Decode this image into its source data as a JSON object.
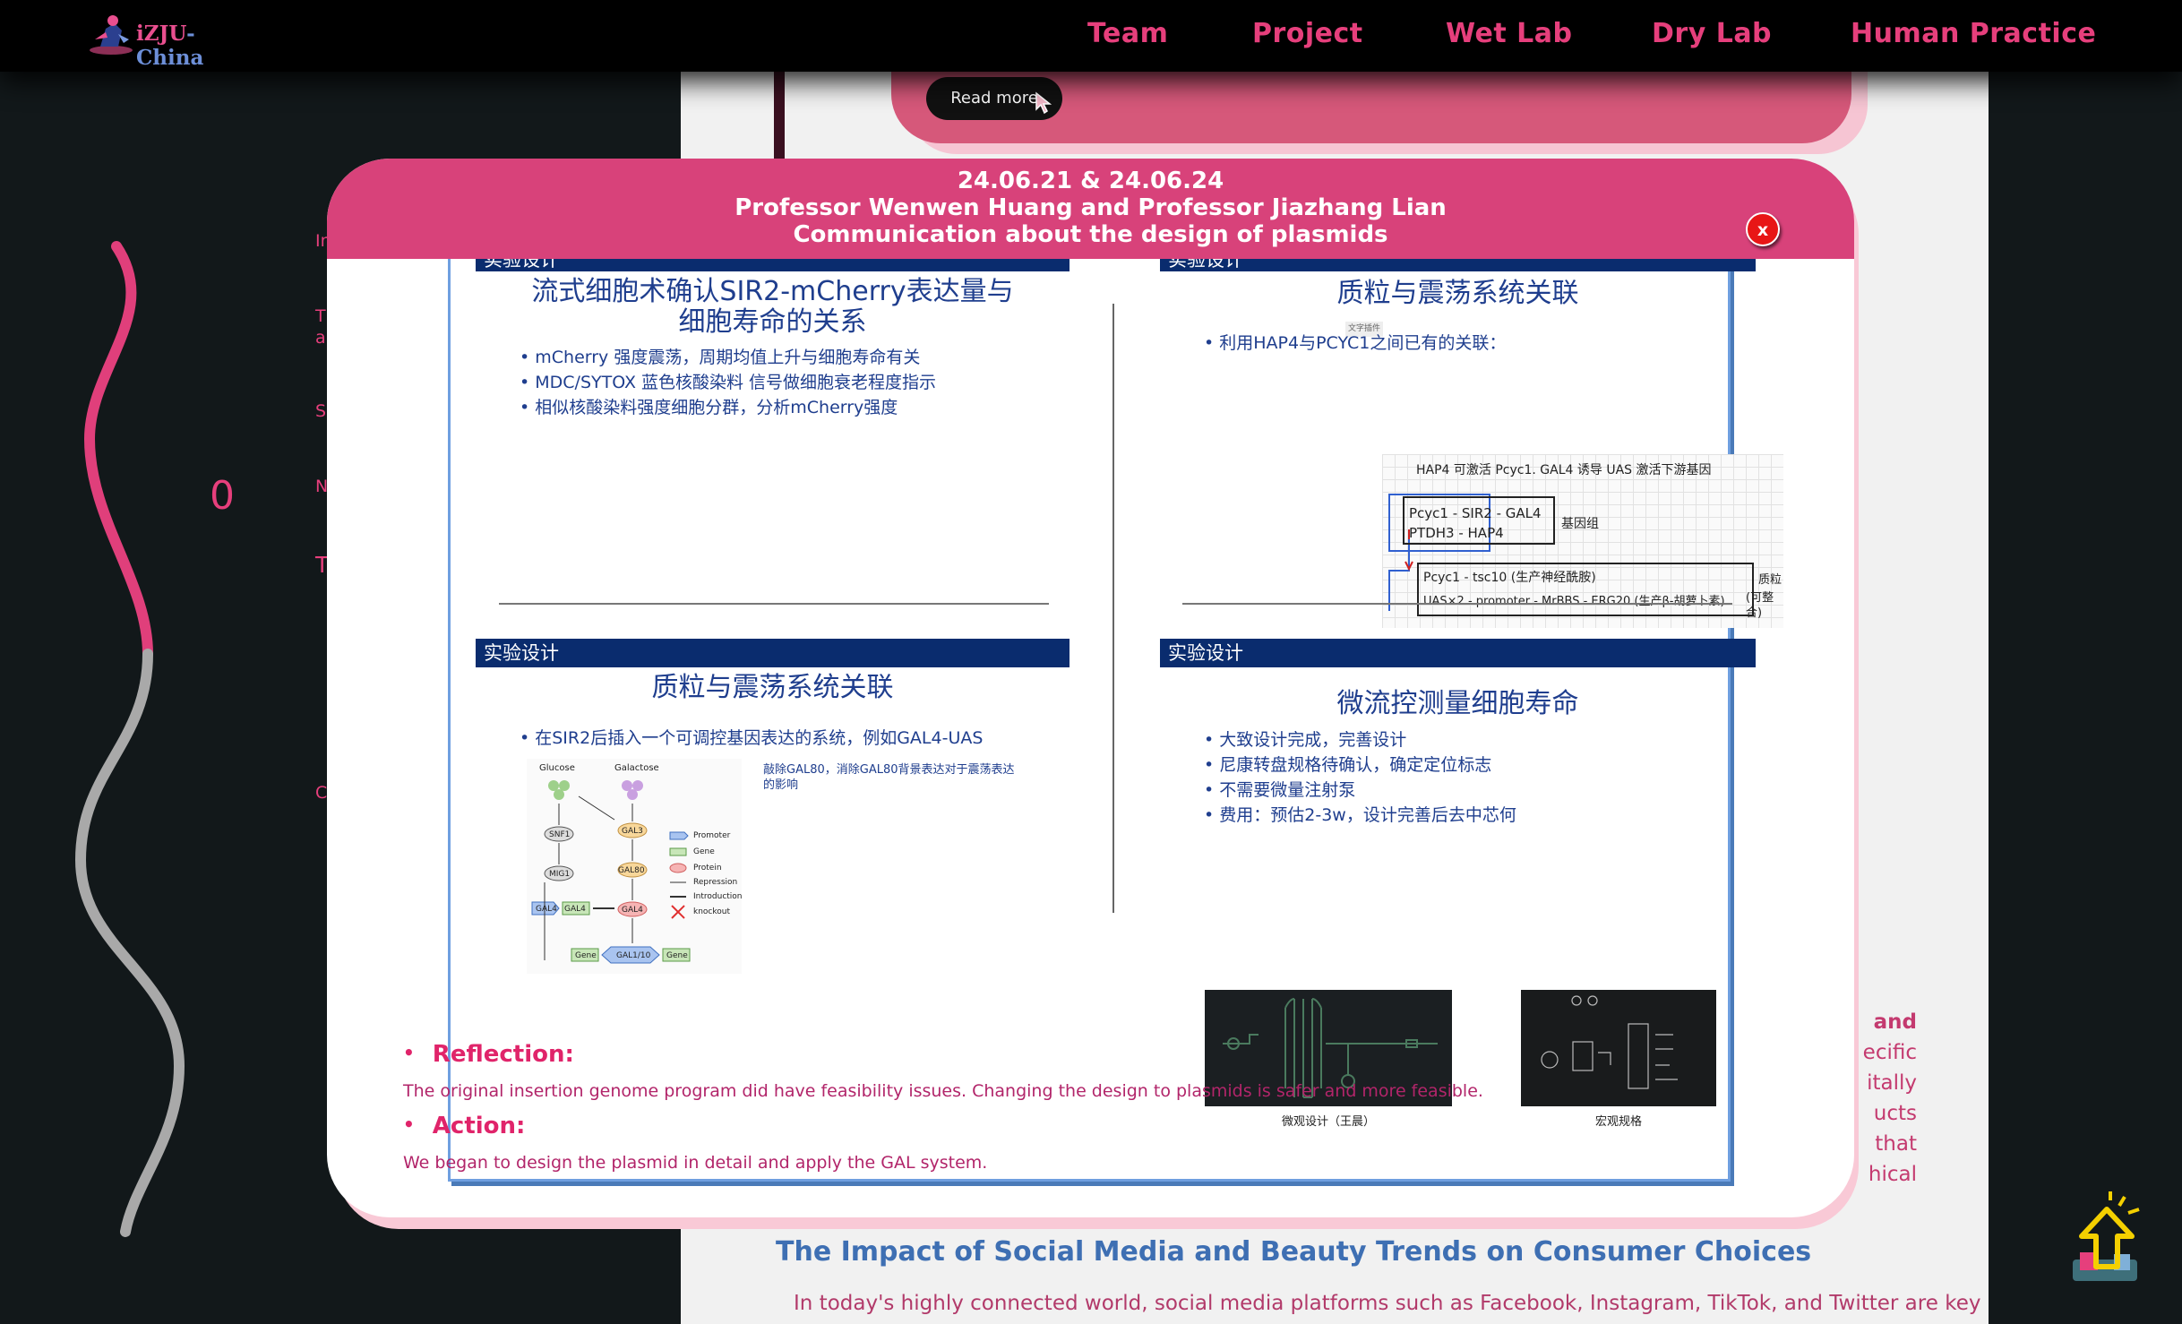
{
  "nav": {
    "logo_text": "iZJU",
    "logo_suffix": "-China",
    "items": [
      "Team",
      "Project",
      "Wet Lab",
      "Dry Lab",
      "Human Practice"
    ]
  },
  "background": {
    "read_more_label": "Read more",
    "left_snippets": [
      "In",
      "T",
      "a",
      "S",
      "N",
      "T",
      "C"
    ],
    "right_snippets": [
      "and",
      "ecific",
      "itally",
      "ucts",
      "that",
      "hical"
    ],
    "section_title": "The Impact of Social Media and Beauty Trends on Consumer Choices",
    "section_para": "In today's highly connected world, social media platforms such as Facebook, Instagram, TikTok, and Twitter are key"
  },
  "modal": {
    "date_line": "24.06.21 & 24.06.24",
    "people_line": "Professor Wenwen Huang and Professor Jiazhang Lian",
    "topic_line": "Communication about the design of plasmids",
    "close_label": "x",
    "slides": [
      {
        "band": "实验设计",
        "title_line1": "流式细胞术确认SIR2-mCherry表达量与",
        "title_line2": "细胞寿命的关系",
        "bullets": [
          "mCherry 强度震荡，周期均值上升与细胞寿命有关",
          "MDC/SYTOX 蓝色核酸染料 信号做细胞衰老程度指示",
          "相似核酸染料强度细胞分群，分析mCherry强度"
        ]
      },
      {
        "band": "实验设计",
        "title_line1": "质粒与震荡系统关联",
        "tag": "文字插件",
        "bullets": [
          "利用HAP4与PCYC1之间已有的关联："
        ],
        "notes": [
          "HAP4 可激活 Pcyc1. GAL4 诱导 UAS 激活下游基因",
          "Pcyc1 - SIR2 - GAL4",
          "PTDH3 - HAP4",
          "基因组",
          "Pcyc1 - tsc10 (生产神经酰胺)",
          "UAS×2 - promoter - MrBBS - ERG20 (生产β-胡萝卜素)",
          "质粒",
          "(可整合)"
        ]
      },
      {
        "band": "实验设计",
        "title_line1": "质粒与震荡系统关联",
        "bullets": [
          "在SIR2后插入一个可调控基因表达的系统，例如GAL4-UAS"
        ],
        "caption": "敲除GAL80，消除GAL80背景表达对于震荡表达的影响",
        "diagram": {
          "glucose": "Glucose",
          "galactose": "Galactose",
          "nodes": [
            "SNF1",
            "MIG1",
            "GAL3",
            "GAL80",
            "GAL4",
            "GAL4",
            "GAL4",
            "Gene",
            "GAL1/10",
            "Gene"
          ],
          "legend": [
            "Promoter",
            "Gene",
            "Protein",
            "Repression",
            "Introduction",
            "knockout"
          ]
        }
      },
      {
        "band": "实验设计",
        "title_line1": "微流控测量细胞寿命",
        "bullets": [
          "大致设计完成，完善设计",
          "尼康转盘规格待确认，确定定位标志",
          "不需要微量注射泵",
          "费用：预估2-3w，设计完善后去中芯何"
        ],
        "image_captions": [
          "微观设计（王晨）",
          "宏观规格"
        ]
      }
    ],
    "reflection_label": "Reflection:",
    "reflection_text": "The original insertion genome program did have feasibility issues. Changing the design to plasmids is safer and more feasible.",
    "action_label": "Action:",
    "action_text": "We began to design the plasmid in detail and apply the GAL system."
  },
  "colors": {
    "accent": "#e63f7c",
    "modal_header": "#d8427a",
    "slide_band": "#0a2c6e",
    "close_button": "#e81616"
  }
}
